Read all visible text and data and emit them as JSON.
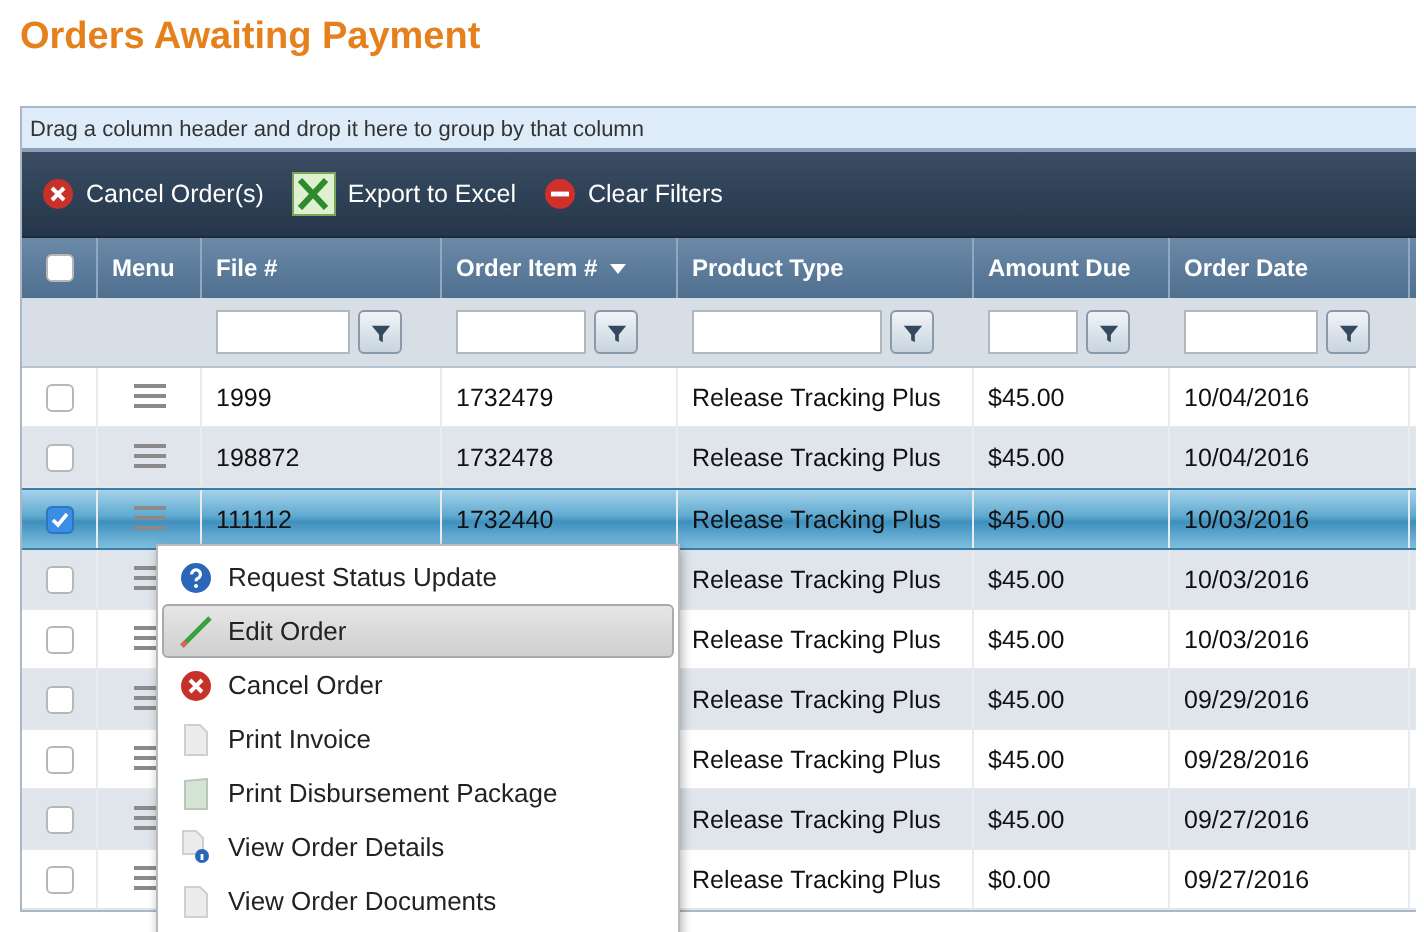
{
  "title": "Orders Awaiting Payment",
  "group_hint": "Drag a column header and drop it here to group by that column",
  "toolbar": [
    {
      "kind": "cancel",
      "label": "Cancel Order(s)"
    },
    {
      "kind": "excel",
      "label": "Export to Excel"
    },
    {
      "kind": "clear",
      "label": "Clear Filters"
    }
  ],
  "header_checkbox": {
    "checked": false
  },
  "columns": [
    {
      "label": "Menu",
      "filter": false,
      "sorted": false
    },
    {
      "label": "File #",
      "filter": true,
      "sorted": false
    },
    {
      "label": "Order Item #",
      "filter": true,
      "sorted": true
    },
    {
      "label": "Product Type",
      "filter": true,
      "sorted": false
    },
    {
      "label": "Amount Due",
      "filter": true,
      "sorted": false
    },
    {
      "label": "Order Date",
      "filter": true,
      "sorted": false
    }
  ],
  "rows": [
    {
      "checked": false,
      "selected": false,
      "file": "1999",
      "order_item": "1732479",
      "product": "Release Tracking Plus",
      "amount": "$45.00",
      "date": "10/04/2016"
    },
    {
      "checked": false,
      "selected": false,
      "file": "198872",
      "order_item": "1732478",
      "product": "Release Tracking Plus",
      "amount": "$45.00",
      "date": "10/04/2016"
    },
    {
      "checked": true,
      "selected": true,
      "file": "111112",
      "order_item": "1732440",
      "product": "Release Tracking Plus",
      "amount": "$45.00",
      "date": "10/03/2016"
    },
    {
      "checked": false,
      "selected": false,
      "product": "Release Tracking Plus",
      "amount": "$45.00",
      "date": "10/03/2016"
    },
    {
      "checked": false,
      "selected": false,
      "product": "Release Tracking Plus",
      "amount": "$45.00",
      "date": "10/03/2016"
    },
    {
      "checked": false,
      "selected": false,
      "product": "Release Tracking Plus",
      "amount": "$45.00",
      "date": "09/29/2016"
    },
    {
      "checked": false,
      "selected": false,
      "product": "Release Tracking Plus",
      "amount": "$45.00",
      "date": "09/28/2016"
    },
    {
      "checked": false,
      "selected": false,
      "product": "Release Tracking Plus",
      "amount": "$45.00",
      "date": "09/27/2016"
    },
    {
      "checked": false,
      "selected": false,
      "product": "Release Tracking Plus",
      "amount": "$0.00",
      "date": "09/27/2016"
    }
  ],
  "context_menu": [
    {
      "kind": "help",
      "label": "Request Status Update",
      "selected": false
    },
    {
      "kind": "edit",
      "label": "Edit Order",
      "selected": true
    },
    {
      "kind": "cancel",
      "label": "Cancel Order",
      "selected": false
    },
    {
      "kind": "document",
      "label": "Print Invoice",
      "selected": false
    },
    {
      "kind": "package",
      "label": "Print Disbursement Package",
      "selected": false
    },
    {
      "kind": "info",
      "label": "View Order Details",
      "selected": false
    },
    {
      "kind": "document",
      "label": "View Order Documents",
      "selected": false
    }
  ]
}
